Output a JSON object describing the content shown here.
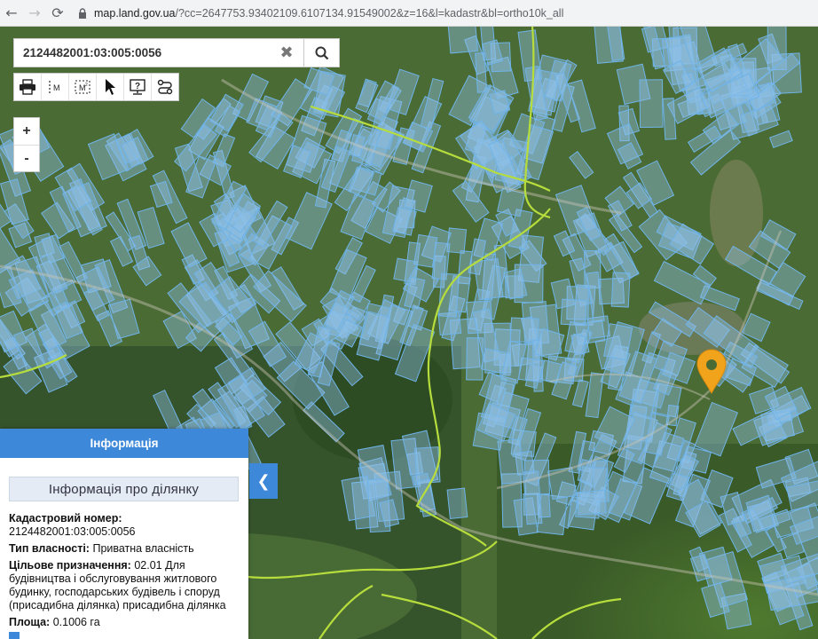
{
  "browser": {
    "back_icon": "arrow-left-icon",
    "forward_icon": "arrow-right-icon",
    "reload_icon": "reload-icon",
    "url_host": "map.land.gov.ua",
    "url_rest": "/?cc=2647753.93402109.6107134.91549002&z=16&l=kadastr&bl=ortho10k_all"
  },
  "search": {
    "value": "2124482001:03:005:0056",
    "clear_label": "✖"
  },
  "toolbar": {
    "tools": [
      "print-icon",
      "measure-distance-icon",
      "measure-area-icon",
      "pointer-icon",
      "info-screen-icon",
      "route-icon"
    ],
    "measure_label": "M"
  },
  "zoom": {
    "in_label": "+",
    "out_label": "-"
  },
  "panel": {
    "header": "Інформація",
    "subheader": "Інформація про ділянку",
    "cadastral_label": "Кадастровий номер:",
    "cadastral_value": "2124482001:03:005:0056",
    "ownership_label": "Тип власності:",
    "ownership_value": "Приватна власність",
    "purpose_label": "Цільове призначення:",
    "purpose_value": "02.01 Для будівництва і обслуговування житлового будинку, господарських будівель і споруд (присадибна ділянка) присадибна ділянка",
    "area_label": "Площа:",
    "area_value": "0.1006 га"
  },
  "collapse_label": "❮",
  "colors": {
    "accent": "#3e88d9",
    "parcel_fill": "#8fc0ea",
    "parcel_stroke": "#6fb3e8",
    "boundary": "#b6dd3c",
    "marker": "#f2a31c"
  }
}
